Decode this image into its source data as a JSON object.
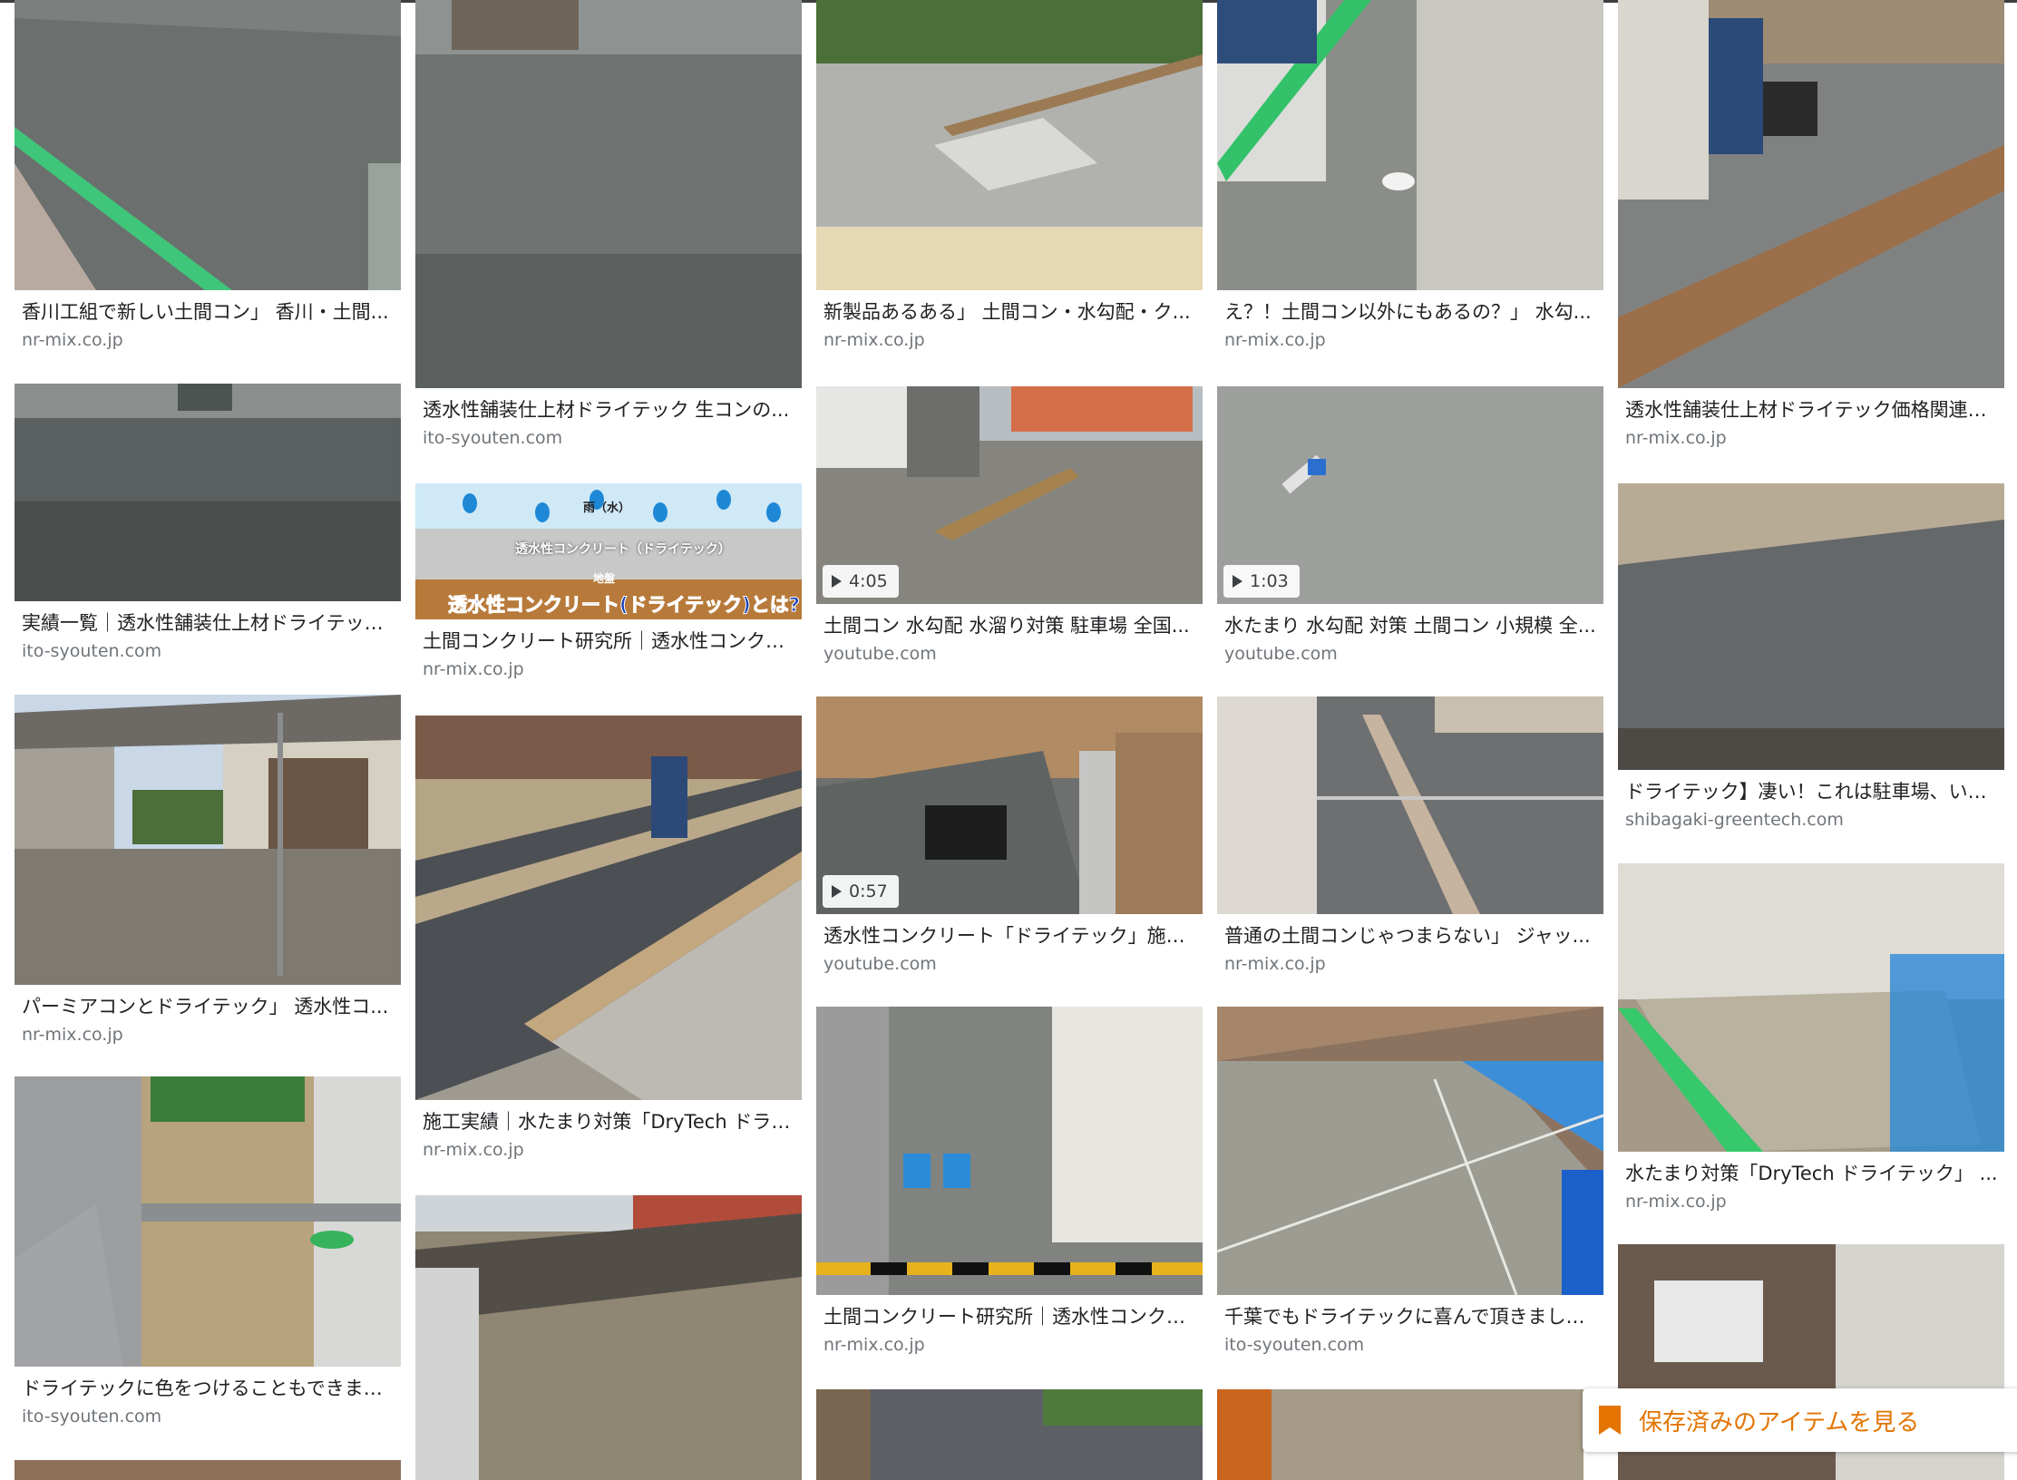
{
  "accent_color": "#e37400",
  "saved_button": {
    "label": "保存済みのアイテムを見る",
    "icon": "bookmark-icon"
  },
  "cards": [
    {
      "title": "香川工組で新しい土間コン」 香川・土間...",
      "source": "nr-mix.co.jp",
      "duration": null
    },
    {
      "title": "実績一覧｜透水性舗装仕上材ドライテック...",
      "source": "ito-syouten.com",
      "duration": null
    },
    {
      "title": "パーミアコンとドライテック」 透水性コ...",
      "source": "nr-mix.co.jp",
      "duration": null
    },
    {
      "title": "ドライテックに色をつけることもできます...",
      "source": "ito-syouten.com",
      "duration": null
    },
    {
      "title": "透水性舗装仕上材ドライテック 生コンの...",
      "source": "ito-syouten.com",
      "duration": null
    },
    {
      "title": "土間コンクリート研究所｜透水性コンクリ...",
      "source": "nr-mix.co.jp",
      "duration": null,
      "diagram": {
        "top": "雨（水）",
        "middle": "透水性コンクリート（ドライテック）",
        "ground": "地盤",
        "caption": "透水性コンクリート(ドライテック)とは?"
      }
    },
    {
      "title": "施工実績｜水たまり対策「DryTech ドライ...",
      "source": "nr-mix.co.jp",
      "duration": null
    },
    {
      "title": "新製品あるある」 土間コン・水勾配・ク...",
      "source": "nr-mix.co.jp",
      "duration": null
    },
    {
      "title": "土間コン 水勾配 水溜り対策 駐車場 全国...",
      "source": "youtube.com",
      "duration": "4:05"
    },
    {
      "title": "透水性コンクリート「ドライテック」施工...",
      "source": "youtube.com",
      "duration": "0:57"
    },
    {
      "title": "土間コンクリート研究所｜透水性コンクリ...",
      "source": "nr-mix.co.jp",
      "duration": null
    },
    {
      "title": "え？！土間コン以外にもあるの？」 水勾...",
      "source": "nr-mix.co.jp",
      "duration": null
    },
    {
      "title": "水たまり 水勾配 対策 土間コン 小規模 全...",
      "source": "youtube.com",
      "duration": "1:03"
    },
    {
      "title": "普通の土間コンじゃつまらない」 ジャッ...",
      "source": "nr-mix.co.jp",
      "duration": null
    },
    {
      "title": "千葉でもドライテックに喜んで頂きました...",
      "source": "ito-syouten.com",
      "duration": null
    },
    {
      "title": "透水性舗装仕上材ドライテック価格関連記...",
      "source": "nr-mix.co.jp",
      "duration": null
    },
    {
      "title": "ドライテック】凄い！これは駐車場、いや...",
      "source": "shibagaki-greentech.com",
      "duration": null
    },
    {
      "title": "水たまり対策「DryTech ドライテック」 ...",
      "source": "nr-mix.co.jp",
      "duration": null
    }
  ]
}
